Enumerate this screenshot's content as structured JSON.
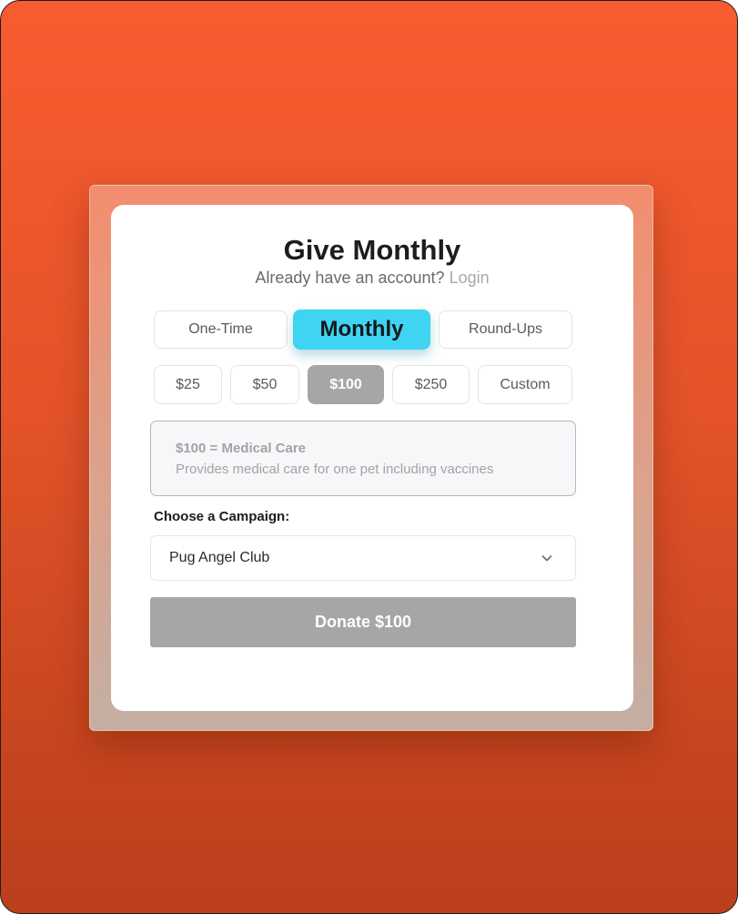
{
  "header": {
    "title": "Give Monthly",
    "subtitle_text": "Already have an account?",
    "login_label": "Login"
  },
  "frequency_tabs": [
    {
      "label": "One-Time",
      "active": false
    },
    {
      "label": "Monthly",
      "active": true
    },
    {
      "label": "Round-Ups",
      "active": false
    }
  ],
  "amounts": [
    {
      "label": "$25",
      "selected": false
    },
    {
      "label": "$50",
      "selected": false
    },
    {
      "label": "$100",
      "selected": true
    },
    {
      "label": "$250",
      "selected": false
    },
    {
      "label": "Custom",
      "selected": false
    }
  ],
  "impact": {
    "title": "$100 = Medical Care",
    "description": "Provides medical care for one pet including vaccines"
  },
  "campaign": {
    "label": "Choose a Campaign:",
    "selected": "Pug Angel Club",
    "icon": "chevron-down-icon"
  },
  "donate_button": {
    "label": "Donate $100"
  },
  "colors": {
    "background": "#f75c30",
    "active_tab": "#3fd4f2",
    "selected_amount": "#a6a5a8",
    "donate_button": "#a6a5a8",
    "card": "#ffffff"
  }
}
